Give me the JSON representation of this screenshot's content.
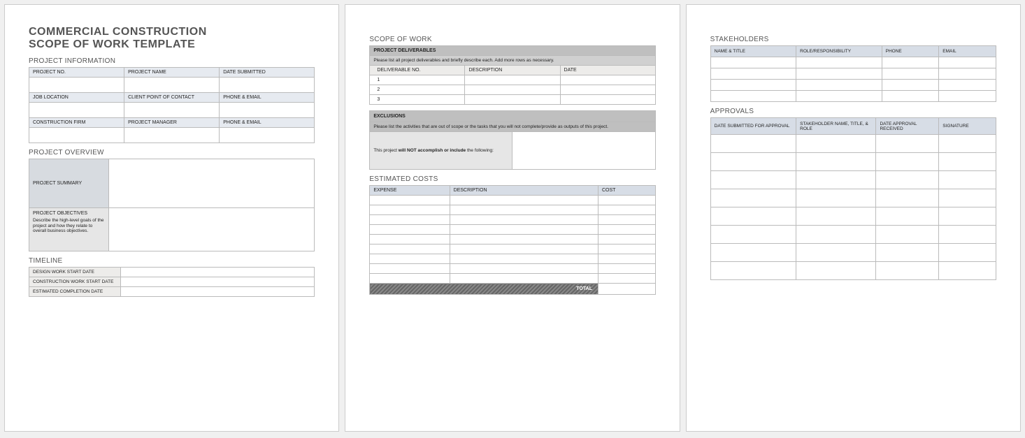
{
  "doc": {
    "title_line1": "COMMERCIAL CONSTRUCTION",
    "title_line2": "SCOPE OF WORK TEMPLATE"
  },
  "sections": {
    "project_info": "PROJECT INFORMATION",
    "project_overview": "PROJECT OVERVIEW",
    "timeline": "TIMELINE",
    "scope_of_work": "SCOPE OF WORK",
    "estimated_costs": "ESTIMATED COSTS",
    "stakeholders": "STAKEHOLDERS",
    "approvals": "APPROVALS"
  },
  "project_info": {
    "project_no": "PROJECT NO.",
    "project_name": "PROJECT NAME",
    "date_submitted": "DATE SUBMITTED",
    "job_location": "JOB LOCATION",
    "client_poc": "CLIENT POINT OF CONTACT",
    "phone_email": "PHONE & EMAIL",
    "construction_firm": "CONSTRUCTION FIRM",
    "project_manager": "PROJECT MANAGER",
    "phone_email2": "PHONE & EMAIL"
  },
  "overview": {
    "summary_label": "PROJECT SUMMARY",
    "objectives_label": "PROJECT OBJECTIVES",
    "objectives_desc": "Describe the high-level goals of the project and how they relate to overall business objectives."
  },
  "timeline": {
    "design_start": "DESIGN WORK START DATE",
    "construction_start": "CONSTRUCTION WORK START DATE",
    "est_completion": "ESTIMATED COMPLETION DATE"
  },
  "deliverables": {
    "banner": "PROJECT DELIVERABLES",
    "desc": "Please list all project deliverables and briefly describe each. Add more rows as necessary.",
    "col_no": "DELIVERABLE NO.",
    "col_desc": "DESCRIPTION",
    "col_date": "DATE",
    "rows": [
      "1",
      "2",
      "3"
    ]
  },
  "exclusions": {
    "banner": "EXCLUSIONS",
    "desc": "Please list the activities that are out of scope or the tasks that you will not complete/provide as outputs of this project.",
    "left_pre": "This project ",
    "left_bold": "will NOT accomplish or include",
    "left_post": " the following:"
  },
  "costs": {
    "expense": "EXPENSE",
    "description": "DESCRIPTION",
    "cost": "COST",
    "total": "TOTAL"
  },
  "stakeholders": {
    "name_title": "NAME & TITLE",
    "role": "ROLE/RESPONSIBILITY",
    "phone": "PHONE",
    "email": "EMAIL"
  },
  "approvals": {
    "date_submitted": "DATE SUBMITTED FOR APPROVAL",
    "stakeholder": "STAKEHOLDER NAME, TITLE, & ROLE",
    "date_received": "DATE APPROVAL RECEIVED",
    "signature": "SIGNATURE"
  }
}
